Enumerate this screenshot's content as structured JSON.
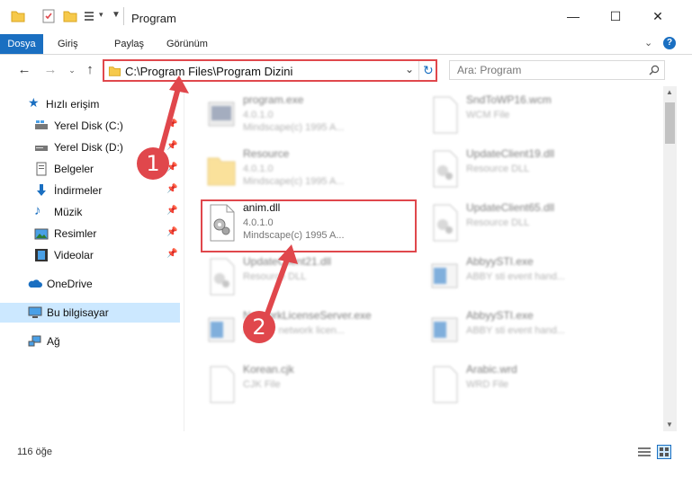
{
  "window": {
    "title": "Program",
    "minimize": "—",
    "maximize": "☐",
    "close": "✕"
  },
  "ribbon": {
    "tabs": [
      "Dosya",
      "Giriş",
      "Paylaş",
      "Görünüm"
    ]
  },
  "address": {
    "path": "C:\\Program Files\\Program Dizini"
  },
  "search": {
    "placeholder": "Ara: Program"
  },
  "sidebar": {
    "items": [
      {
        "label": "Hızlı erişim",
        "icon": "star-icon"
      },
      {
        "label": "Yerel Disk (C:)",
        "icon": "drive-icon"
      },
      {
        "label": "Yerel Disk (D:)",
        "icon": "drive-icon"
      },
      {
        "label": "Belgeler",
        "icon": "document-icon"
      },
      {
        "label": "İndirmeler",
        "icon": "download-icon"
      },
      {
        "label": "Müzik",
        "icon": "music-icon"
      },
      {
        "label": "Resimler",
        "icon": "picture-icon"
      },
      {
        "label": "Videolar",
        "icon": "video-icon"
      },
      {
        "label": "OneDrive",
        "icon": "cloud-icon"
      },
      {
        "label": "Bu bilgisayar",
        "icon": "computer-icon"
      },
      {
        "label": "Ağ",
        "icon": "network-icon"
      }
    ]
  },
  "files": [
    {
      "name": "program.exe",
      "line1": "4.0.1.0",
      "line2": "Mindscape(c) 1995 A..."
    },
    {
      "name": "SndToWP16.wcm",
      "line1": "WCM File",
      "line2": ""
    },
    {
      "name": "Resource",
      "line1": "4.0.1.0",
      "line2": "Mindscape(c) 1995 A..."
    },
    {
      "name": "UpdateClient19.dll",
      "line1": "Resource DLL",
      "line2": ""
    },
    {
      "name": "anim.dll",
      "line1": "4.0.1.0",
      "line2": "Mindscape(c) 1995 A..."
    },
    {
      "name": "UpdateClient65.dll",
      "line1": "Resource DLL",
      "line2": ""
    },
    {
      "name": "UpdateClient21.dll",
      "line1": "Resource DLL",
      "line2": ""
    },
    {
      "name": "AbbyySTI.exe",
      "line1": "ABBY sti event hand...",
      "line2": ""
    },
    {
      "name": "NetworkLicenseServer.exe",
      "line1": "ABBYY network licen...",
      "line2": ""
    },
    {
      "name": "AbbyySTI.exe",
      "line1": "ABBY sti event hand...",
      "line2": ""
    },
    {
      "name": "Korean.cjk",
      "line1": "CJK File",
      "line2": ""
    },
    {
      "name": "Arabic.wrd",
      "line1": "WRD File",
      "line2": ""
    }
  ],
  "status": {
    "count": "116 öğe"
  },
  "callouts": [
    "1",
    "2"
  ],
  "colors": {
    "accent": "#1a6fc1",
    "highlight": "#e0474c",
    "selected": "#cce8ff"
  }
}
